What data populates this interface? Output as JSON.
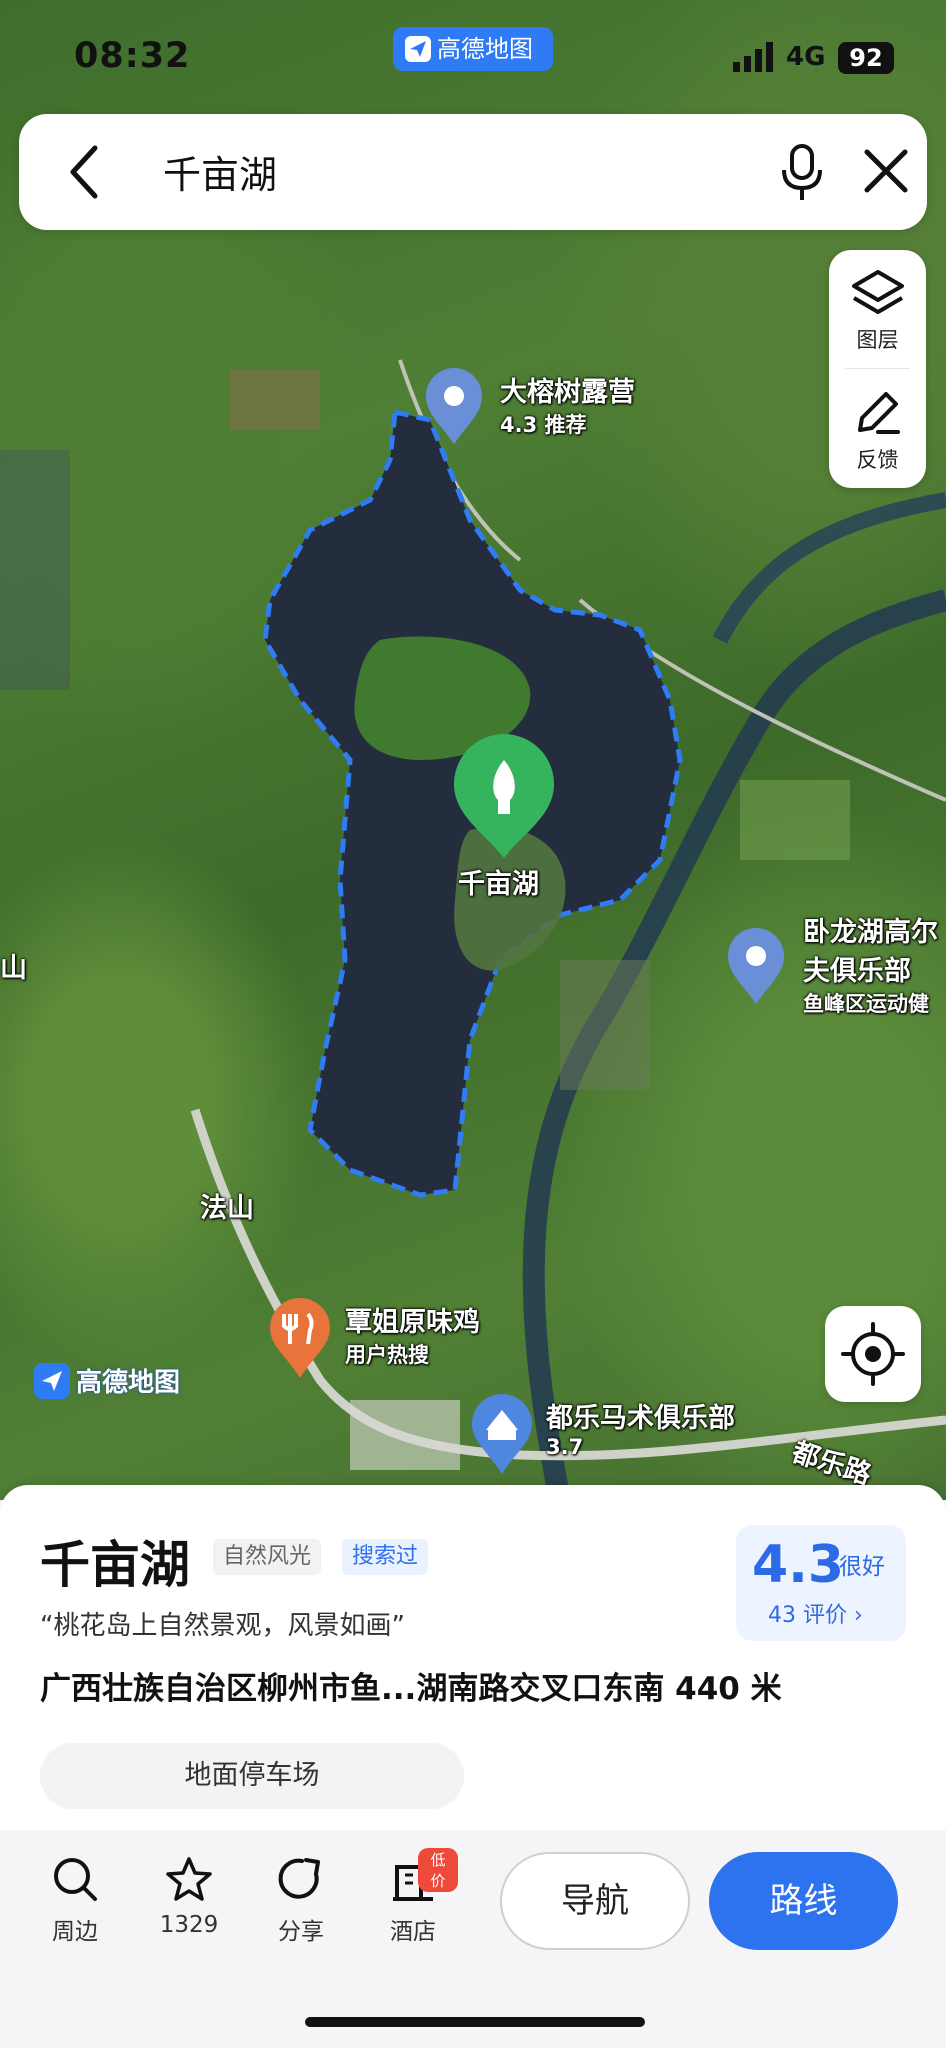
{
  "status": {
    "time": "08:32",
    "app_badge": "高德地图",
    "network": "4G",
    "battery": "92"
  },
  "search": {
    "query": "千亩湖"
  },
  "map_controls": {
    "layers_label": "图层",
    "feedback_label": "反馈"
  },
  "map": {
    "watermark": "高德地图",
    "pois": {
      "camp": {
        "name": "大榕树露营",
        "sub": "4.3 推荐"
      },
      "lake": {
        "name": "千亩湖"
      },
      "golf": {
        "name_line1": "卧龙湖高尔",
        "name_line2": "夫俱乐部",
        "sub": "鱼峰区运动健"
      },
      "fashan": {
        "name": "法山"
      },
      "chicken": {
        "name": "覃姐原味鸡",
        "sub": "用户热搜"
      },
      "horse": {
        "name": "都乐马术俱乐部",
        "sub": "3.7"
      },
      "road": {
        "name": "都乐路"
      },
      "edge_left": {
        "name": "山"
      }
    },
    "colors": {
      "lake_outline": "#2f7cf5",
      "lake_pin": "#36b45d",
      "poi_pin": "#6a8fd6",
      "food_pin": "#e8743b"
    }
  },
  "place": {
    "title": "千亩湖",
    "tags": [
      "自然风光",
      "搜索过"
    ],
    "quote": "“桃花岛上自然景观，风景如画”",
    "address": "广西壮族自治区柳州市鱼...湖南路交叉口东南 440 米",
    "rating": "4.3",
    "rating_word": "很好",
    "rating_count": "43 评价 ›",
    "parking": "地面停车场"
  },
  "actions": {
    "nearby": "周边",
    "favorite_count": "1329",
    "share": "分享",
    "hotel": "酒店",
    "hotel_badge": "低价",
    "navigate": "导航",
    "route": "路线"
  }
}
